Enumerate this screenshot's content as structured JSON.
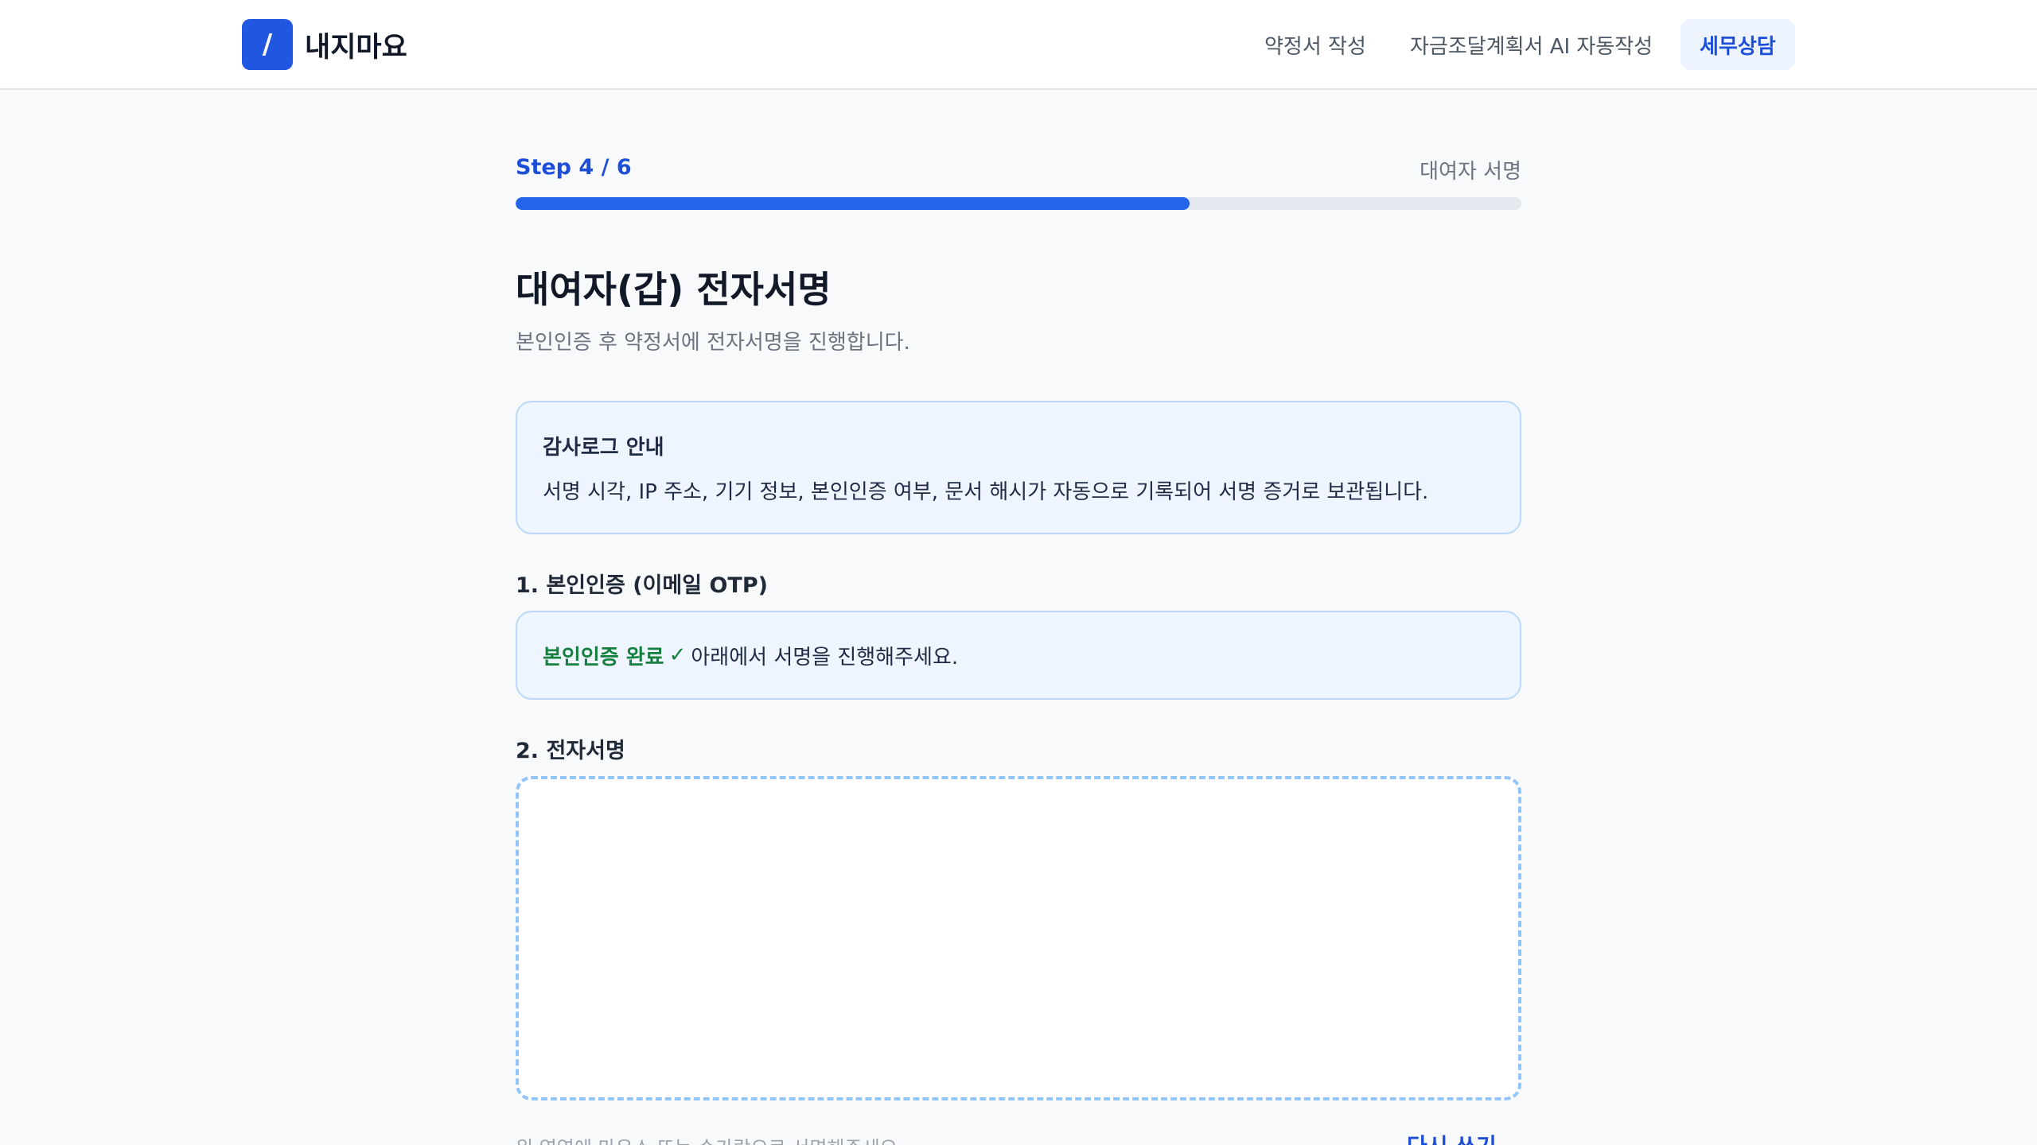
{
  "header": {
    "logo_glyph": "/",
    "brand": "내지마요",
    "nav": [
      {
        "label": "약정서 작성"
      },
      {
        "label": "자금조달계획서 AI 자동작성"
      },
      {
        "label": "세무상담"
      }
    ]
  },
  "progress": {
    "step_label": "Step 4 / 6",
    "step_name": "대여자 서명",
    "fraction": 0.67
  },
  "main": {
    "title": "대여자(갑) 전자서명",
    "subtitle": "본인인증 후 약정서에 전자서명을 진행합니다."
  },
  "audit": {
    "title": "감사로그 안내",
    "body": "서명 시각, IP 주소, 기기 정보, 본인인증 여부, 문서 해시가 자동으로 기록되어 서명 증거로 보관됩니다."
  },
  "verification": {
    "section_label": "1. 본인인증 (이메일 OTP)",
    "done_label": "본인인증 완료",
    "check_glyph": "✓",
    "message": "아래에서 서명을 진행해주세요."
  },
  "signature": {
    "section_label": "2. 전자서명",
    "hint": "위 영역에 마우스 또는 손가락으로 서명해주세요.",
    "redo_label": "다시 쓰기"
  },
  "colors": {
    "accent": "#2563eb",
    "success": "#15803d",
    "info_bg": "#eef5ff"
  }
}
